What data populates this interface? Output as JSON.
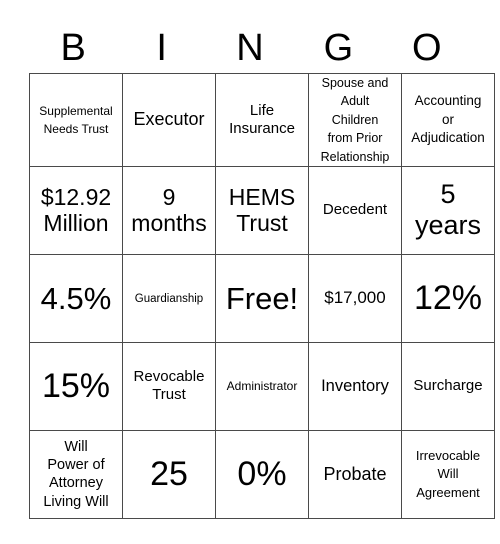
{
  "header": {
    "letters": [
      "B",
      "I",
      "N",
      "G",
      "O"
    ]
  },
  "grid": {
    "rows": [
      [
        "Supplemental Needs Trust",
        "Executor",
        "Life\nInsurance",
        "Spouse and\nAdult\nChildren\nfrom Prior\nRelationship",
        "Accounting\nor\nAdjudication"
      ],
      [
        "$12.92\nMillion",
        "9\nmonths",
        "HEMS\nTrust",
        "Decedent",
        "5\nyears"
      ],
      [
        "4.5%",
        "Guardianship",
        "Free!",
        "$17,000",
        "12%"
      ],
      [
        "15%",
        "Revocable\nTrust",
        "Administrator",
        "Inventory",
        "Surcharge"
      ],
      [
        "Will\nPower of\nAttorney\nLiving Will",
        "25",
        "0%",
        "Probate",
        "Irrevocable\nWill\nAgreement"
      ]
    ],
    "free_space": "Free!"
  }
}
